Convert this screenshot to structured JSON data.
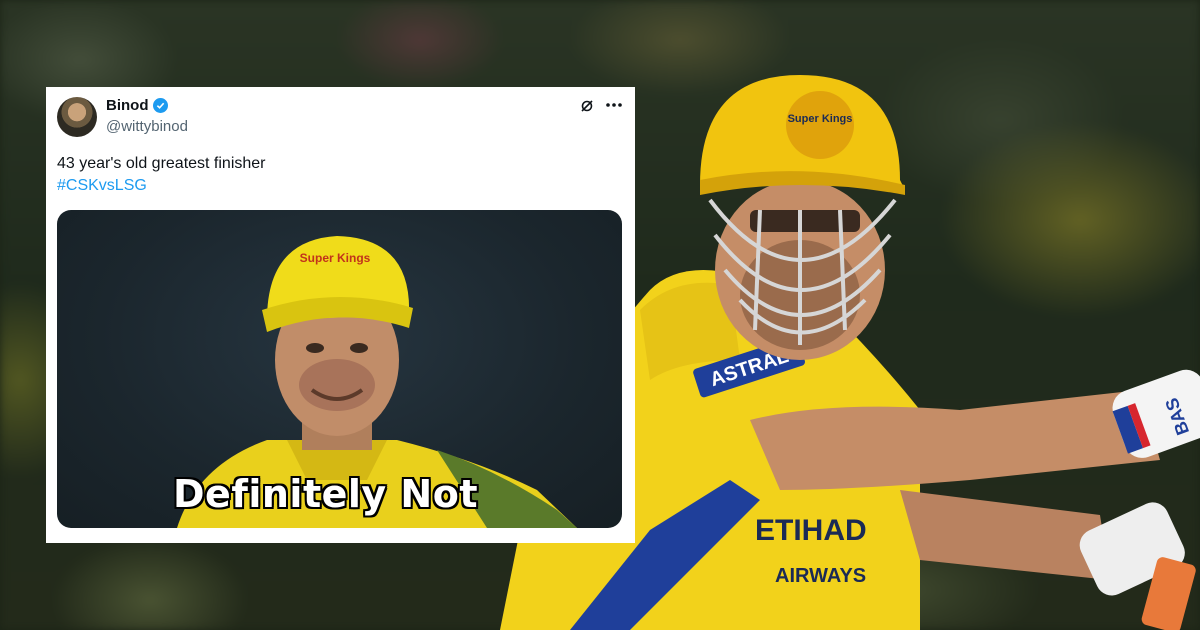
{
  "colors": {
    "link": "#1d9bf0",
    "jersey_yellow": "#f2d21b",
    "text_primary": "#0f1419",
    "text_secondary": "#536471"
  },
  "tweet": {
    "author_name": "Binod",
    "verified": true,
    "handle": "@wittybinod",
    "text_line": "43 year's old greatest finisher",
    "hashtag": "#CSKvsLSG",
    "icons": [
      "grok-icon",
      "more-options-icon",
      "verified-badge-icon"
    ],
    "media": {
      "caption": "Definitely Not",
      "cap_logo_text": "Super Kings"
    }
  },
  "photo": {
    "helmet_logo_text": "Super Kings",
    "sleeve_text": "ASTRAL",
    "chest_text": "ETIHAD",
    "chest_subtext": "AIRWAYS",
    "glove_text": "BAS"
  }
}
